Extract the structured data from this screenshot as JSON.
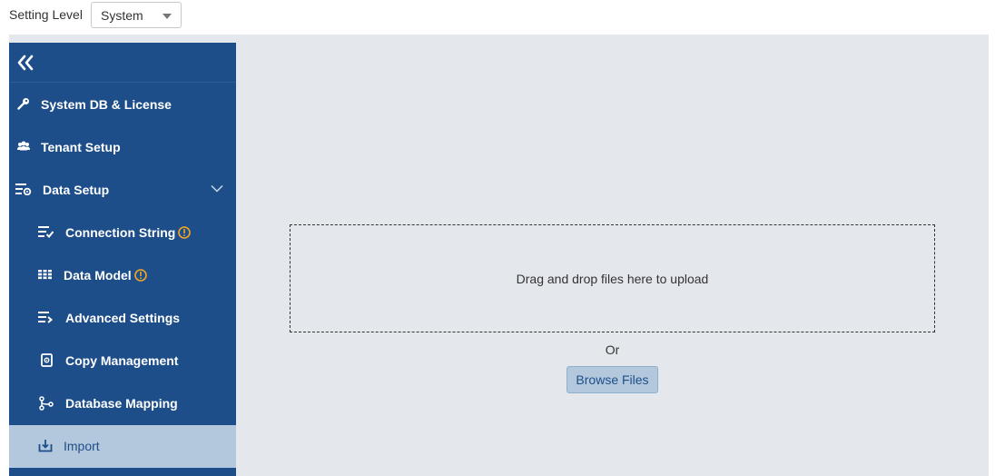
{
  "topbar": {
    "setting_level_label": "Setting Level",
    "level_select": {
      "value": "System"
    }
  },
  "sidebar": {
    "collapse_icon": "double-chevron-left-icon",
    "items": [
      {
        "label": "System DB & License",
        "icon": "key-icon"
      },
      {
        "label": "Tenant Setup",
        "icon": "users-icon"
      },
      {
        "label": "Data Setup",
        "icon": "list-settings-icon",
        "expanded": true
      },
      {
        "label": "Connection String",
        "icon": "list-check-icon",
        "warning": true
      },
      {
        "label": "Data Model",
        "icon": "grid-table-icon",
        "warning": true
      },
      {
        "label": "Advanced Settings",
        "icon": "list-arrow-icon"
      },
      {
        "label": "Copy Management",
        "icon": "copy-doc-icon"
      },
      {
        "label": "Database Mapping",
        "icon": "mapping-icon"
      },
      {
        "label": "Import",
        "icon": "download-tray-icon",
        "active": true
      }
    ]
  },
  "main": {
    "dropzone_text": "Drag and drop files here to upload",
    "or_text": "Or",
    "browse_button": "Browse Files"
  },
  "colors": {
    "sidebar_bg": "#1d4e89",
    "active_bg": "#b3c8dc",
    "content_bg": "#e4e8ec",
    "warning": "#f5a623"
  }
}
